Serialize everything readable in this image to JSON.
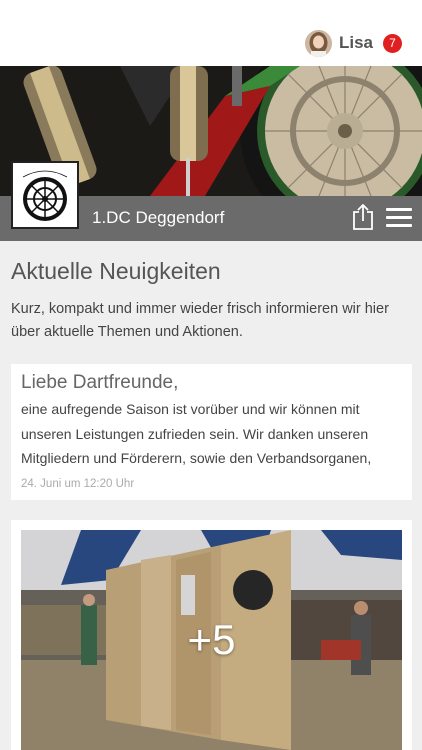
{
  "user": {
    "name": "Lisa",
    "notification_count": "7"
  },
  "club": {
    "name": "1.DC Deggendorf",
    "logo_text": "1.DC DEGGENDORF"
  },
  "news": {
    "title": "Aktuelle Neuigkeiten",
    "intro": "Kurz, kompakt und immer wieder frisch informieren wir hier über aktuelle Themen und Aktionen."
  },
  "posts": [
    {
      "title": "Liebe Dartfreunde,",
      "text": "eine aufregende Saison ist vorüber und wir können mit unseren Leistungen zufrieden sein. Wir danken unseren Mitgliedern und Förderern, sowie den Verbandsorganen,",
      "date": "24. Juni um 12:20 Uhr"
    }
  ],
  "gallery": {
    "more_count": "+5"
  },
  "colors": {
    "badge": "#e02020",
    "clubbar": "#6b6b6b",
    "background": "#efefef"
  },
  "icons": [
    "share-icon",
    "menu-icon",
    "avatar",
    "dartboard-logo"
  ]
}
